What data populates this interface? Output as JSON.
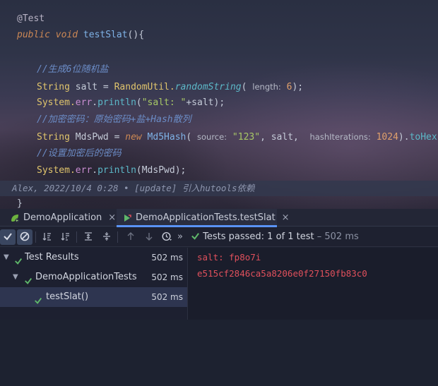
{
  "editor": {
    "lines": {
      "annotation": "@Test",
      "method_kw": "public void",
      "method_name": "testSlat",
      "method_tail": "(){",
      "comment1": "//生成6位随机盐",
      "l1_type": "String",
      "l1_var": " salt = ",
      "l1_class": "RandomUtil.",
      "l1_method": "randomString",
      "l1_open": "( ",
      "l1_hint": "length:",
      "l1_num": " 6",
      "l1_close": ");",
      "l2_sys": "System.",
      "l2_err": "err",
      "l2_dot": ".",
      "l2_method": "println",
      "l2_open": "(",
      "l2_str": "\"salt: \"",
      "l2_rest": "+salt);",
      "comment2": "//加密密码：原始密码+盐+Hash散列",
      "l3_type": "String",
      "l3_var": " MdsPwd = ",
      "l3_new": "new",
      "l3_class": " Md5Hash",
      "l3_open": "( ",
      "l3_hint1": "source:",
      "l3_str": " \"123\"",
      "l3_mid": ", salt,  ",
      "l3_hint2": "hashIterations:",
      "l3_num": " 1024",
      "l3_close": ").",
      "l3_method": "toHex",
      "l3_end": "();",
      "comment3": "//设置加密后的密码",
      "l4_sys": "System.",
      "l4_err": "err",
      "l4_dot": ".",
      "l4_method": "println",
      "l4_rest": "(MdsPwd);"
    },
    "blame": "Alex, 2022/10/4 0:28 • [update] 引入hutools依赖",
    "closing": "}"
  },
  "tabs": [
    {
      "label": "DemoApplication",
      "icon": "spring-run-icon",
      "close": "×"
    },
    {
      "label": "DemoApplicationTests.testSlat",
      "icon": "test-run-icon",
      "close": "×"
    }
  ],
  "toolbar": {
    "more": "»",
    "status_prefix": "Tests passed:",
    "status_count": " 1",
    "status_mid": " of 1 test",
    "status_time": " – 502 ms"
  },
  "tree": [
    {
      "label": "Test Results",
      "time": "502 ms",
      "level": 0
    },
    {
      "label": "DemoApplicationTests",
      "time": "502 ms",
      "level": 1
    },
    {
      "label": "testSlat()",
      "time": "502 ms",
      "level": 2
    }
  ],
  "console": [
    "salt: fp8o7i",
    "e515cf2846ca5a8206e0f27150fb83c0"
  ],
  "colors": {
    "pass_green": "#5fb86a",
    "error_red": "#e0505c",
    "tab_underline": "#5a93f5"
  }
}
